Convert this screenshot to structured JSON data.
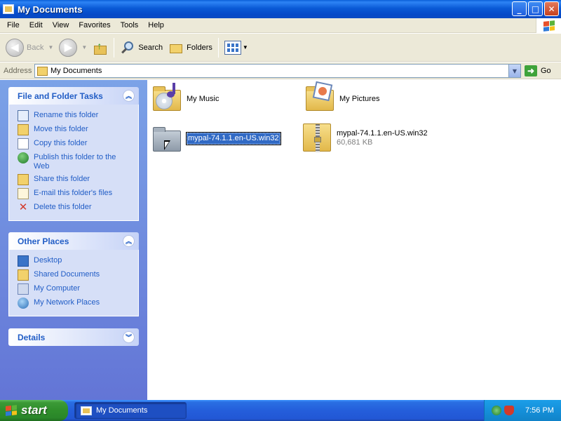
{
  "window": {
    "title": "My Documents",
    "controls": {
      "minimize": "_",
      "maximize": "□",
      "close": "✕"
    }
  },
  "menu": [
    "File",
    "Edit",
    "View",
    "Favorites",
    "Tools",
    "Help"
  ],
  "toolbar": {
    "back_label": "Back",
    "search_label": "Search",
    "folders_label": "Folders"
  },
  "address": {
    "label": "Address",
    "value": "My Documents",
    "go_label": "Go"
  },
  "taskpane": {
    "file_folder_tasks": {
      "title": "File and Folder Tasks",
      "items": [
        {
          "label": "Rename this folder",
          "icon": "rename-icon"
        },
        {
          "label": "Move this folder",
          "icon": "move-icon"
        },
        {
          "label": "Copy this folder",
          "icon": "copy-icon"
        },
        {
          "label": "Publish this folder to the Web",
          "icon": "publish-web-icon"
        },
        {
          "label": "Share this folder",
          "icon": "share-icon"
        },
        {
          "label": "E-mail this folder's files",
          "icon": "email-icon"
        },
        {
          "label": "Delete this folder",
          "icon": "delete-icon"
        }
      ]
    },
    "other_places": {
      "title": "Other Places",
      "items": [
        {
          "label": "Desktop",
          "icon": "desktop-icon"
        },
        {
          "label": "Shared Documents",
          "icon": "shared-documents-icon"
        },
        {
          "label": "My Computer",
          "icon": "my-computer-icon"
        },
        {
          "label": "My Network Places",
          "icon": "network-places-icon"
        }
      ]
    },
    "details": {
      "title": "Details"
    }
  },
  "files": [
    {
      "name": "My Music",
      "type": "music-folder-icon"
    },
    {
      "name": "My Pictures",
      "type": "pictures-folder-icon"
    },
    {
      "name": "mypal-74.1.1.en-US.win32",
      "type": "folder-icon",
      "state": "renaming"
    },
    {
      "name": "mypal-74.1.1.en-US.win32",
      "size": "60,681 KB",
      "type": "zip-folder-icon"
    }
  ],
  "taskbar": {
    "start_label": "start",
    "task_label": "My Documents",
    "clock": "7:56 PM"
  },
  "colors": {
    "titlebar": "#0a5ad6",
    "taskpane_link": "#215dc6",
    "selection": "#316ac5",
    "start_green": "#3c9a37"
  }
}
